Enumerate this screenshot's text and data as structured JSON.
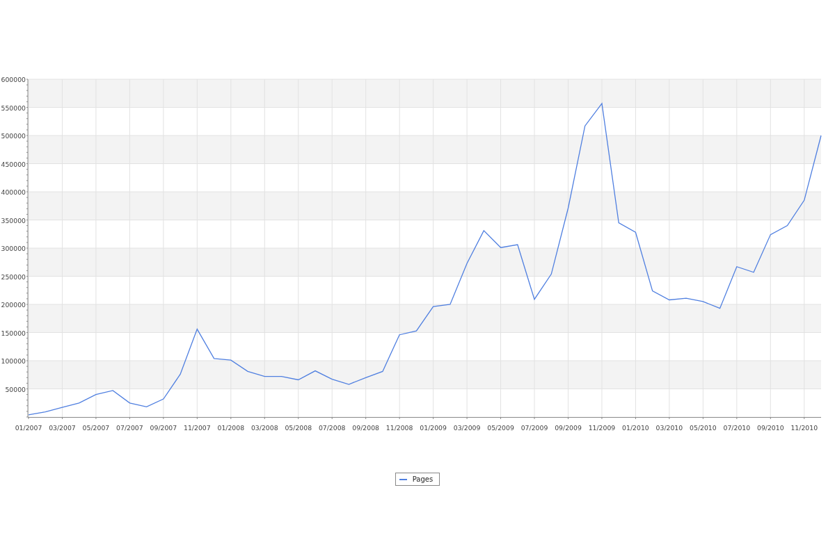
{
  "chart": {
    "chart_data": {
      "type": "line",
      "categories": [
        "01/2007",
        null,
        "03/2007",
        null,
        "05/2007",
        null,
        "07/2007",
        null,
        "09/2007",
        null,
        "11/2007",
        null,
        "01/2008",
        null,
        "03/2008",
        null,
        "05/2008",
        null,
        "07/2008",
        null,
        "09/2008",
        null,
        "11/2008",
        null,
        "01/2009",
        null,
        "03/2009",
        null,
        "05/2009",
        null,
        "07/2009",
        null,
        "09/2009",
        null,
        "11/2009",
        null,
        "01/2010",
        null,
        "03/2010",
        null,
        "05/2010",
        null,
        "07/2010",
        null,
        "09/2010",
        null,
        "11/2010",
        null
      ],
      "series": [
        {
          "name": "Pages",
          "color": "#4f7fe0",
          "values": [
            4000,
            9000,
            17000,
            25000,
            40000,
            47000,
            25000,
            18000,
            32000,
            76000,
            156000,
            104000,
            101000,
            81000,
            72000,
            72000,
            66000,
            82000,
            67000,
            58000,
            70000,
            81000,
            146000,
            153000,
            196000,
            200000,
            273000,
            331000,
            301000,
            306000,
            209000,
            254000,
            371000,
            517000,
            557000,
            345000,
            328000,
            224000,
            208000,
            211000,
            205000,
            193000,
            267000,
            257000,
            324000,
            340000,
            385000,
            500000
          ]
        }
      ],
      "ylim": [
        0,
        600000
      ],
      "grid": true,
      "yticks": [
        50000,
        100000,
        150000,
        200000,
        250000,
        300000,
        350000,
        400000,
        450000,
        500000,
        550000,
        600000
      ]
    }
  }
}
